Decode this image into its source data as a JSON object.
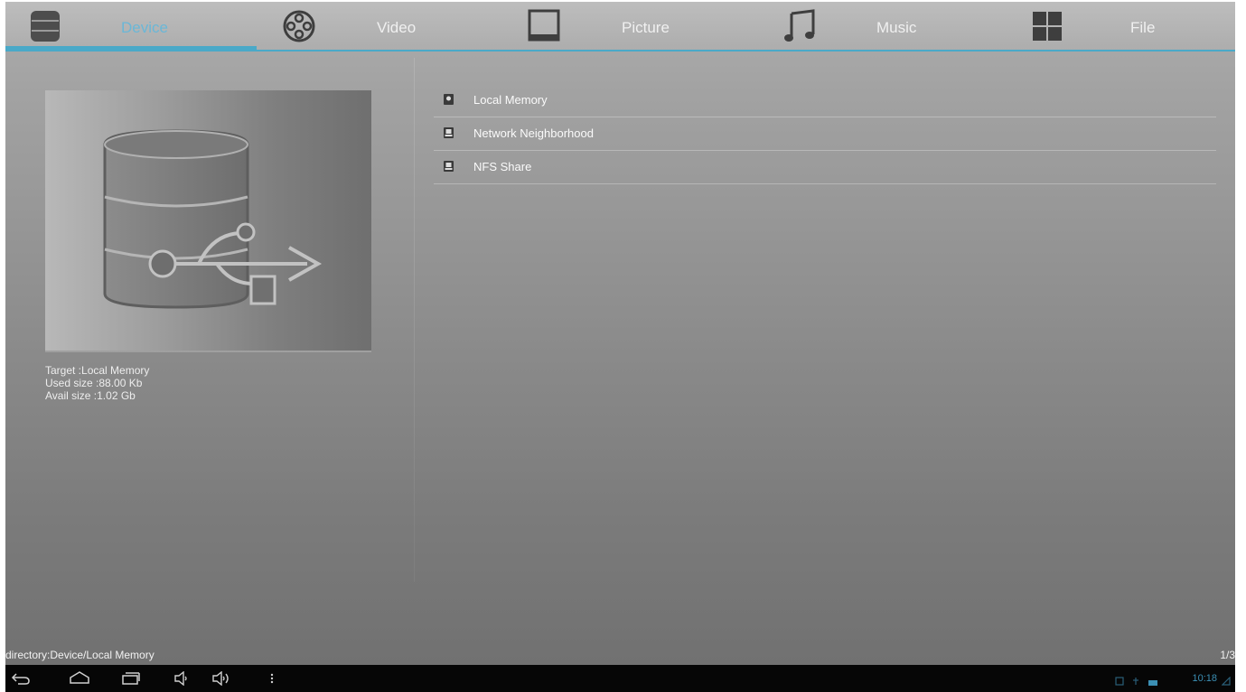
{
  "tabs": [
    {
      "id": "device",
      "label": "Device",
      "icon": "database-icon",
      "active": true
    },
    {
      "id": "video",
      "label": "Video",
      "icon": "film-reel-icon",
      "active": false
    },
    {
      "id": "picture",
      "label": "Picture",
      "icon": "picture-frame-icon",
      "active": false
    },
    {
      "id": "music",
      "label": "Music",
      "icon": "music-note-icon",
      "active": false
    },
    {
      "id": "file",
      "label": "File",
      "icon": "grid-icon",
      "active": false
    }
  ],
  "device_info": {
    "target": "Target :Local Memory",
    "used": "Used size :88.00 Kb",
    "avail": "Avail size :1.02 Gb"
  },
  "devices": [
    {
      "label": "Local Memory",
      "icon": "local-memory-icon"
    },
    {
      "label": "Network Neighborhood",
      "icon": "network-icon"
    },
    {
      "label": "NFS Share",
      "icon": "nfs-share-icon"
    }
  ],
  "footer": {
    "directory": "directory:Device/Local Memory",
    "page": "1/3"
  },
  "system_bar": {
    "time": "10:18",
    "icons": [
      "back-icon",
      "home-icon",
      "recent-apps-icon",
      "volume-down-icon",
      "volume-up-icon",
      "menu-dots-icon"
    ]
  },
  "colors": {
    "accent": "#4aa9c8",
    "active_tab_text": "#6ab7d7",
    "clock": "#3b8fb4"
  }
}
